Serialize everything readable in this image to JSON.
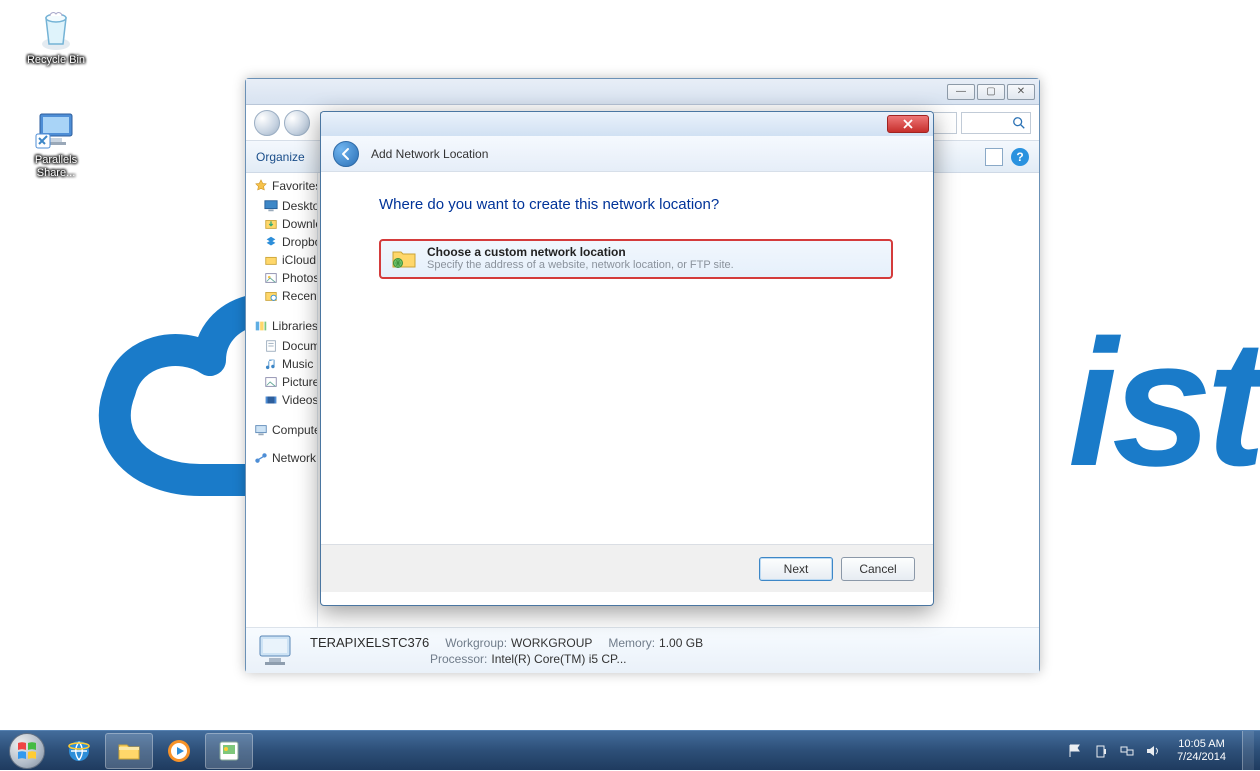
{
  "desktop": {
    "icons": {
      "recycle_bin": "Recycle Bin",
      "parallels_share": "Parallels Share..."
    }
  },
  "explorer": {
    "toolbar": {
      "organize": "Organize"
    },
    "sidebar": {
      "favorites": "Favorites",
      "fav_items": {
        "desktop": "Desktop",
        "downloads": "Downloads",
        "dropbox": "Dropbox",
        "icloud": "iCloud",
        "photos": "Photos",
        "recent": "Recent Places"
      },
      "libraries": "Libraries",
      "lib_items": {
        "documents": "Documents",
        "music": "Music",
        "pictures": "Pictures",
        "videos": "Videos"
      },
      "computer": "Computer",
      "network": "Network"
    },
    "details": {
      "computer_name": "TERAPIXELSTC376",
      "workgroup_label": "Workgroup:",
      "workgroup_value": "WORKGROUP",
      "memory_label": "Memory:",
      "memory_value": "1.00 GB",
      "processor_label": "Processor:",
      "processor_value": "Intel(R) Core(TM) i5 CP..."
    }
  },
  "wizard": {
    "title": "Add Network Location",
    "heading": "Where do you want to create this network location?",
    "option": {
      "title": "Choose a custom network location",
      "subtitle": "Specify the address of a website, network location, or FTP site."
    },
    "buttons": {
      "next": "Next",
      "cancel": "Cancel"
    }
  },
  "taskbar": {
    "time": "10:05 AM",
    "date": "7/24/2014"
  }
}
